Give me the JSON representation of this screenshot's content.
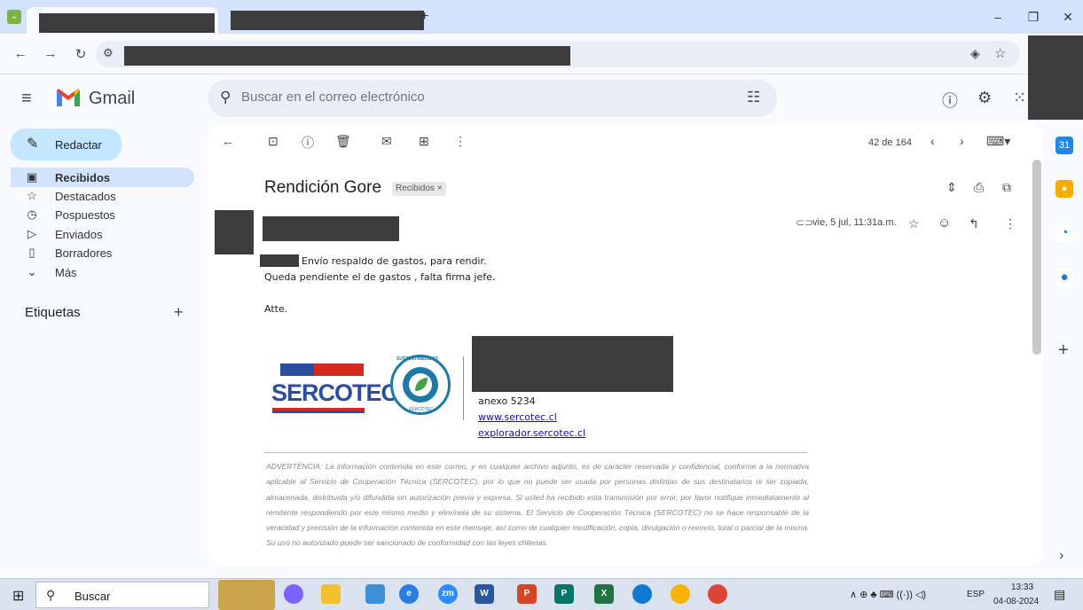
{
  "browser": {
    "new_tab_icon": "plus-icon"
  },
  "gmail": {
    "brand": "Gmail",
    "search_placeholder": "Buscar en el correo electrónico",
    "compose": "Redactar",
    "nav": [
      {
        "label": "Recibidos",
        "icon": "inbox-icon"
      },
      {
        "label": "Destacados",
        "icon": "star-icon"
      },
      {
        "label": "Pospuestos",
        "icon": "clock-icon"
      },
      {
        "label": "Enviados",
        "icon": "send-icon"
      },
      {
        "label": "Borradores",
        "icon": "draft-icon"
      },
      {
        "label": "Más",
        "icon": "chevron-down-icon"
      }
    ],
    "labels_title": "Etiquetas"
  },
  "message": {
    "counter": "42 de 164",
    "subject": "Rendición Gore",
    "tag": "Recibidos",
    "date": "vie, 5 jul, 11:31a.m.",
    "body": [
      "Envío respaldo de gastos, para rendir.",
      "Queda pendiente el de gastos , falta firma jefe.",
      "Atte."
    ],
    "signature": {
      "logo_text": "SERCOTEC",
      "seal_top": "SUSTENTABILIDAD",
      "seal_bottom": "SERCOTEC",
      "annex": "anexo 5234",
      "link1": "www.sercotec.cl",
      "link2": "explorador.sercotec.cl"
    },
    "disclaimer": "ADVERTENCIA: La información contenida en este correo, y en cualquier archivo adjunto, es de carácter reservada y confidencial, conforme a la normativa aplicable al Servicio de Cooperación Técnica (SERCOTEC), por lo que no puede ser usada por personas distintas de sus destinatarios ni ser copiada, almacenada, distribuida y/o difundida sin autorización previa y expresa. Si usted ha recibido esta transmisión por error, por favor notifique inmediatamente al remitente respondiendo por este mismo medio y elimínela de su sistema. El Servicio de Cooperación Técnica (SERCOTEC) no se hace responsable de la veracidad y precisión de la información contenida en este mensaje, así como de cualquier modificación, copia, divulgación o reenvío, total o parcial de la misma. Su uso no autorizado puede ser sancionado de conformidad con las leyes chilenas."
  },
  "taskbar": {
    "search": "Buscar",
    "lang": "ESP",
    "time": "13:33",
    "date": "04-08-2024",
    "apps": [
      "zm",
      "W",
      "P",
      "P",
      "X"
    ]
  },
  "colors": {
    "accent": "#c2e7ff",
    "sercotec_blue": "#2b4da0",
    "sercotec_red": "#d52b1e"
  }
}
